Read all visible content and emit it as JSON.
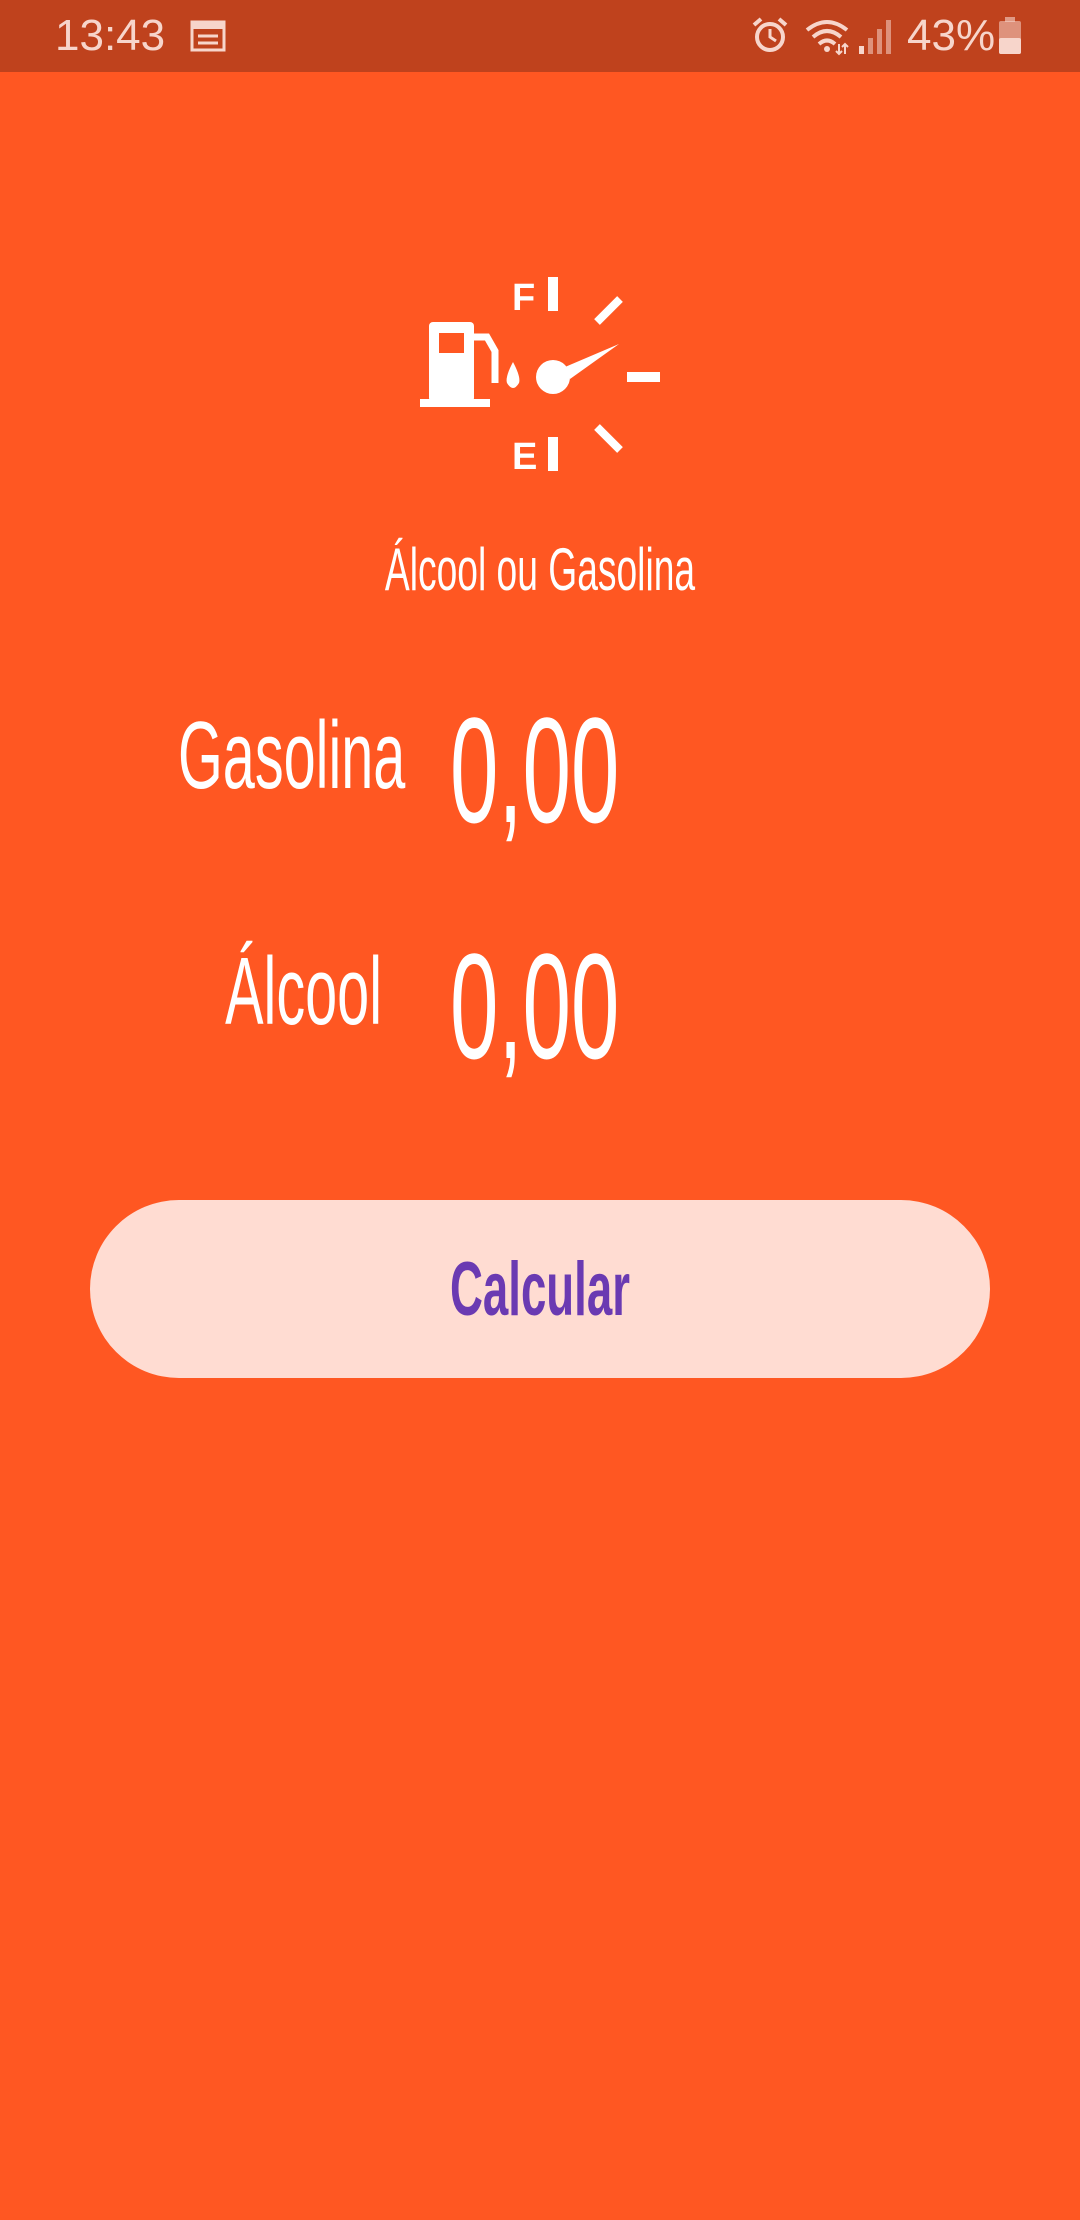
{
  "status_bar": {
    "time": "13:43",
    "battery_percent": "43%",
    "icons": [
      "calendar-icon",
      "alarm-icon",
      "wifi-icon",
      "signal-icon",
      "battery-icon"
    ]
  },
  "app": {
    "logo_icon": "fuel-gauge-icon",
    "title": "Álcool ou Gasolina"
  },
  "form": {
    "gasolina_label": "Gasolina",
    "gasolina_placeholder": "0,00",
    "alcool_label": "Álcool",
    "alcool_placeholder": "0,00"
  },
  "button": {
    "label": "Calcular"
  },
  "colors": {
    "background": "#FF5722",
    "status_bar": "#BF421D",
    "button_bg": "#FFDCD2",
    "button_text": "#6A3AB2",
    "text": "#FFFFFF"
  }
}
